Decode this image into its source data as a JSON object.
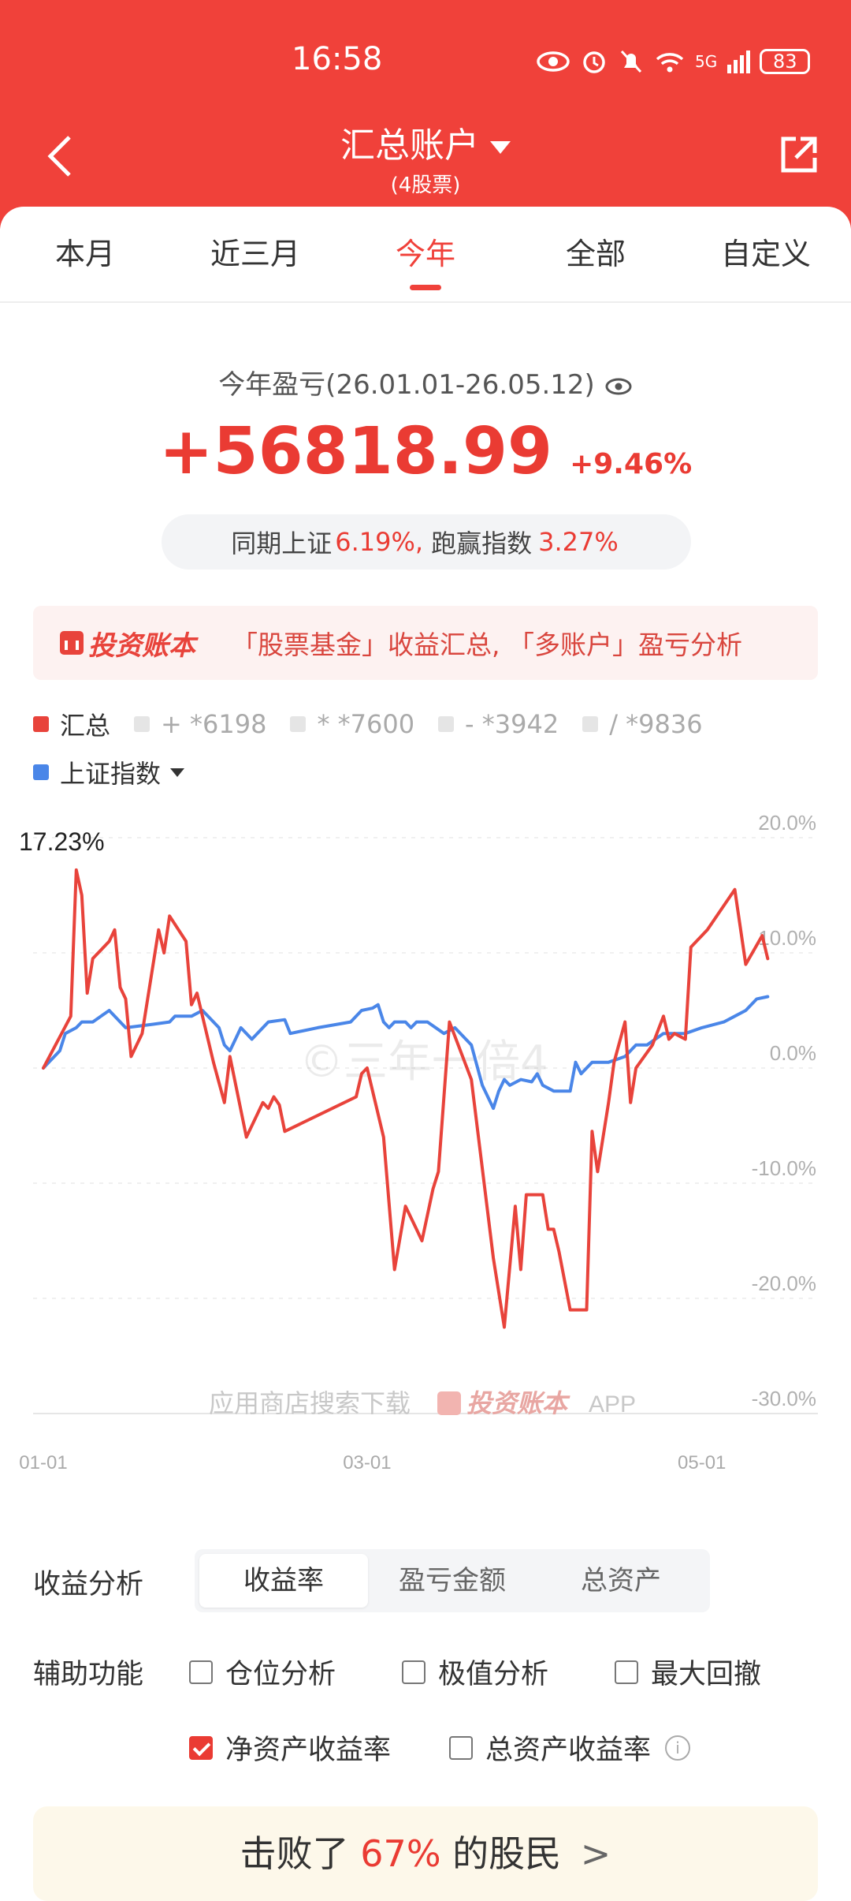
{
  "status_bar": {
    "time": "16:58",
    "network": "5G",
    "battery": "83"
  },
  "header": {
    "title": "汇总账户",
    "subtitle": "(4股票)"
  },
  "tabs": [
    {
      "label": "本月",
      "active": false
    },
    {
      "label": "近三月",
      "active": false
    },
    {
      "label": "今年",
      "active": true
    },
    {
      "label": "全部",
      "active": false
    },
    {
      "label": "自定义",
      "active": false
    }
  ],
  "summary": {
    "period_label": "今年盈亏(26.01.01-26.05.12)",
    "amount": "+56818.99",
    "percent": "+9.46%",
    "compare_prefix": "同期上证",
    "index_return": "6.19%,",
    "compare_middle": "跑赢指数",
    "excess_return": "3.27%"
  },
  "promo": {
    "logo": "投资账本",
    "text": "「股票基金」收益汇总, 「多账户」盈亏分析"
  },
  "legend": {
    "items": [
      {
        "label": "汇总",
        "color": "#e8433b",
        "active": true
      },
      {
        "label": "+ *6198",
        "color": "#e5e5e5",
        "active": false
      },
      {
        "label": "* *7600",
        "color": "#e5e5e5",
        "active": false
      },
      {
        "label": "- *3942",
        "color": "#e5e5e5",
        "active": false
      },
      {
        "label": "/ *9836",
        "color": "#e5e5e5",
        "active": false
      }
    ],
    "benchmark": {
      "label": "上证指数",
      "color": "#4a86e8"
    }
  },
  "chart_data": {
    "type": "line",
    "peak_label": "17.23%",
    "ylim": [
      -30,
      20
    ],
    "y_ticks": [
      "20.0%",
      "10.0%",
      "0.0%",
      "-10.0%",
      "-20.0%",
      "-30.0%"
    ],
    "x_ticks": [
      {
        "label": "01-01",
        "day": 0
      },
      {
        "label": "03-01",
        "day": 59
      },
      {
        "label": "05-01",
        "day": 120
      }
    ],
    "watermark": "©三年一倍4",
    "download_text": "应用商店搜索下载",
    "download_brand": "投资账本",
    "download_suffix": "APP",
    "series": [
      {
        "name": "汇总",
        "color": "#e8433b",
        "points": [
          [
            0,
            0
          ],
          [
            5,
            4.5
          ],
          [
            6,
            17.2
          ],
          [
            7,
            15
          ],
          [
            8,
            6.5
          ],
          [
            9,
            9.5
          ],
          [
            12,
            11
          ],
          [
            13,
            12
          ],
          [
            14,
            7
          ],
          [
            15,
            6
          ],
          [
            16,
            1
          ],
          [
            18,
            3
          ],
          [
            21,
            12
          ],
          [
            22,
            10
          ],
          [
            23,
            13.2
          ],
          [
            26,
            11
          ],
          [
            27,
            5.5
          ],
          [
            28,
            6.5
          ],
          [
            31,
            0.5
          ],
          [
            33,
            -3
          ],
          [
            34,
            1
          ],
          [
            37,
            -6
          ],
          [
            40,
            -3
          ],
          [
            41,
            -3.5
          ],
          [
            42,
            -2.5
          ],
          [
            43,
            -3.2
          ],
          [
            44,
            -5.5
          ],
          [
            57,
            -2.5
          ],
          [
            58,
            -0.5
          ],
          [
            59,
            0
          ],
          [
            62,
            -6
          ],
          [
            64,
            -17.5
          ],
          [
            66,
            -12
          ],
          [
            68,
            -14
          ],
          [
            69,
            -15
          ],
          [
            71,
            -10.5
          ],
          [
            72,
            -9
          ],
          [
            74,
            4
          ],
          [
            78,
            -1
          ],
          [
            82,
            -16.5
          ],
          [
            84,
            -22.5
          ],
          [
            86,
            -12
          ],
          [
            87,
            -17.5
          ],
          [
            88,
            -11
          ],
          [
            91,
            -11
          ],
          [
            92,
            -14
          ],
          [
            93,
            -14
          ],
          [
            94,
            -16
          ],
          [
            96,
            -21
          ],
          [
            99,
            -21
          ],
          [
            100,
            -5.5
          ],
          [
            101,
            -9
          ],
          [
            103,
            -3
          ],
          [
            104,
            0.5
          ],
          [
            106,
            4
          ],
          [
            107,
            -3
          ],
          [
            108,
            0
          ],
          [
            111,
            2
          ],
          [
            113,
            4.5
          ],
          [
            114,
            2.5
          ],
          [
            115,
            3
          ],
          [
            117,
            2.5
          ],
          [
            118,
            10.5
          ],
          [
            119,
            11
          ],
          [
            121,
            12
          ],
          [
            126,
            15.5
          ],
          [
            128,
            9
          ],
          [
            131,
            11.5
          ],
          [
            132,
            9.5
          ]
        ]
      },
      {
        "name": "上证指数",
        "color": "#4a86e8",
        "points": [
          [
            0,
            0
          ],
          [
            3,
            1.5
          ],
          [
            4,
            3
          ],
          [
            6,
            3.5
          ],
          [
            7,
            4
          ],
          [
            9,
            4
          ],
          [
            12,
            5
          ],
          [
            15,
            3.5
          ],
          [
            20,
            3.8
          ],
          [
            23,
            4
          ],
          [
            24,
            4.5
          ],
          [
            27,
            4.5
          ],
          [
            29,
            5
          ],
          [
            32,
            3.5
          ],
          [
            33,
            2
          ],
          [
            34,
            1.5
          ],
          [
            35,
            2.5
          ],
          [
            36,
            3.5
          ],
          [
            38,
            2.5
          ],
          [
            41,
            4
          ],
          [
            44,
            4.2
          ],
          [
            45,
            3
          ],
          [
            50,
            3.5
          ],
          [
            56,
            4
          ],
          [
            58,
            5
          ],
          [
            60,
            5.2
          ],
          [
            61,
            5.5
          ],
          [
            62,
            4
          ],
          [
            63,
            3.5
          ],
          [
            64,
            4
          ],
          [
            66,
            4
          ],
          [
            67,
            3.5
          ],
          [
            68,
            4
          ],
          [
            70,
            4
          ],
          [
            73,
            3
          ],
          [
            75,
            3.5
          ],
          [
            78,
            2
          ],
          [
            80,
            -1.5
          ],
          [
            82,
            -3.5
          ],
          [
            83,
            -2
          ],
          [
            84,
            -1
          ],
          [
            85,
            -1.5
          ],
          [
            87,
            -1
          ],
          [
            89,
            -1.2
          ],
          [
            90,
            -0.5
          ],
          [
            91,
            -1.5
          ],
          [
            93,
            -2
          ],
          [
            96,
            -2
          ],
          [
            97,
            0.5
          ],
          [
            98,
            -0.5
          ],
          [
            100,
            0.5
          ],
          [
            103,
            0.5
          ],
          [
            106,
            1
          ],
          [
            108,
            2
          ],
          [
            110,
            2
          ],
          [
            113,
            3
          ],
          [
            115,
            3
          ],
          [
            117,
            3
          ],
          [
            120,
            3.5
          ],
          [
            124,
            4
          ],
          [
            126,
            4.5
          ],
          [
            128,
            5
          ],
          [
            130,
            6
          ],
          [
            132,
            6.2
          ]
        ]
      }
    ]
  },
  "analysis": {
    "label": "收益分析",
    "options": [
      {
        "label": "收益率",
        "active": true
      },
      {
        "label": "盈亏金额",
        "active": false
      },
      {
        "label": "总资产",
        "active": false
      }
    ]
  },
  "aux": {
    "label": "辅助功能",
    "options": [
      {
        "label": "仓位分析",
        "checked": false
      },
      {
        "label": "极值分析",
        "checked": false
      },
      {
        "label": "最大回撤",
        "checked": false
      },
      {
        "label": "净资产收益率",
        "checked": true
      },
      {
        "label": "总资产收益率",
        "checked": false
      }
    ]
  },
  "beat": {
    "prefix": "击败了",
    "percent": "67%",
    "suffix": "的股民",
    "arrow": ">"
  }
}
